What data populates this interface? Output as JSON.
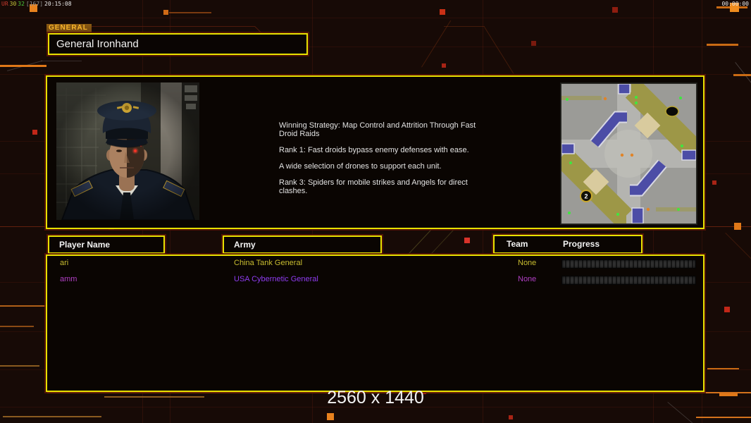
{
  "hud": {
    "perf_overlay": {
      "tag": "UR",
      "val_a": "30",
      "val_b": "32",
      "val_c": "[167]",
      "clock": "20:15:08"
    },
    "session_clock": "00:00:00",
    "resolution": "2560 x 1440"
  },
  "general": {
    "tab_label": "GENERAL",
    "name": "General Ironhand",
    "strategy": [
      "Winning Strategy: Map Control and Attrition Through Fast Droid Raids",
      "Rank 1: Fast droids bypass enemy defenses with ease.",
      "A wide selection of drones to support each unit.",
      "Rank 3: Spiders for mobile strikes and Angels for direct clashes."
    ],
    "minimap": {
      "marker_label": "2"
    }
  },
  "player_table": {
    "headers": {
      "player_name": "Player Name",
      "army": "Army",
      "team": "Team",
      "progress": "Progress"
    },
    "rows": [
      {
        "name": "ari",
        "army": "China Tank General",
        "team": "None",
        "progress_percent": 0,
        "name_color": "#c9bd30",
        "army_color": "#c9bd30",
        "team_color": "#c9bd30"
      },
      {
        "name": "amm",
        "army": "USA Cybernetic General",
        "team": "None",
        "progress_percent": 0,
        "name_color": "#b13fc4",
        "army_color": "#8f3cf0",
        "team_color": "#b13fc4"
      }
    ]
  },
  "colors": {
    "accent_yellow": "#e8e100",
    "accent_orange": "#e07818",
    "background": "#170a06",
    "text": "#f2f2f2"
  }
}
